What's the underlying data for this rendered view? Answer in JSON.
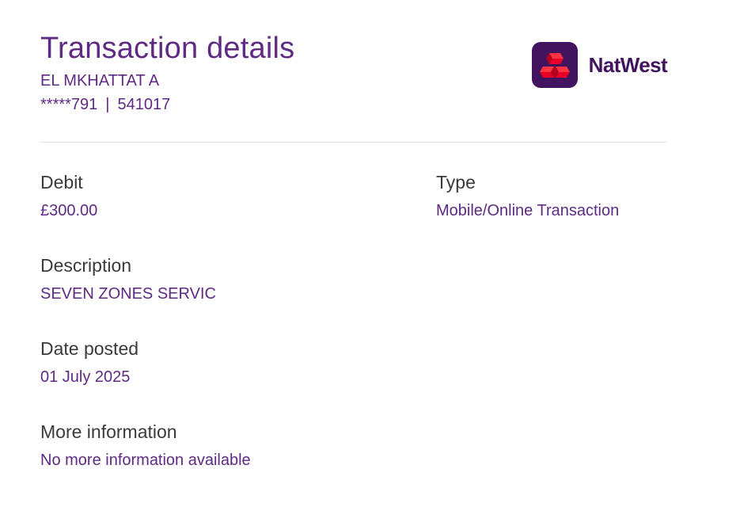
{
  "header": {
    "title": "Transaction details",
    "account_name": "EL MKHATTAT A",
    "account_number": "*****791",
    "sort_code": "541017",
    "separator": "|"
  },
  "brand": {
    "name": "NatWest",
    "logo_icon": "natwest-cubes-icon",
    "logo_bg": "#42145f",
    "logo_accent": "#e60028"
  },
  "colors": {
    "accent": "#5e2a84",
    "label": "#3a3a3a",
    "divider": "#e3e3e3"
  },
  "fields": {
    "debit": {
      "label": "Debit",
      "value": "£300.00"
    },
    "type": {
      "label": "Type",
      "value": "Mobile/Online Transaction"
    },
    "description": {
      "label": "Description",
      "value": "SEVEN ZONES SERVIC"
    },
    "date_posted": {
      "label": "Date posted",
      "value": "01 July 2025"
    },
    "more_information": {
      "label": "More information",
      "value": "No more information available"
    }
  }
}
